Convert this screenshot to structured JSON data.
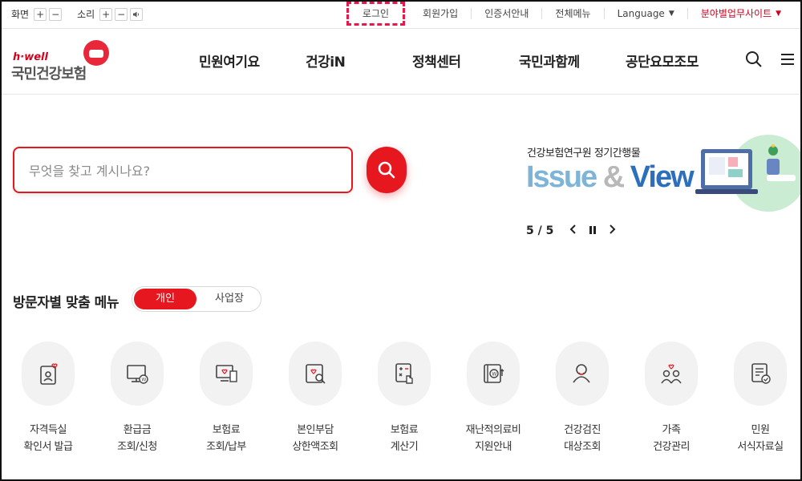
{
  "utility": {
    "screen_label": "화면",
    "sound_label": "소리",
    "plus": "+",
    "minus": "−",
    "links": [
      "로그인",
      "회원가입",
      "인증서안내",
      "전체메뉴"
    ],
    "language": "Language",
    "field_site": "분야별업무사이트"
  },
  "logo": {
    "tagline": "h·well",
    "name": "국민건강보험"
  },
  "nav": {
    "items": [
      "민원여기요",
      "건강iN",
      "정책센터",
      "국민과함께",
      "공단요모조모"
    ]
  },
  "search": {
    "placeholder": "무엇을 찾고 계시나요?"
  },
  "banner": {
    "subtitle": "건강보험연구원 정기간행물",
    "title_issue": "Issue",
    "title_amp": "&",
    "title_view": "View",
    "counter": "5 / 5"
  },
  "custom_menu": {
    "title": "방문자별 맞춤 메뉴",
    "tabs": [
      "개인",
      "사업장"
    ]
  },
  "quick_menu": [
    {
      "line1": "자격득실",
      "line2": "확인서 발급"
    },
    {
      "line1": "환급금",
      "line2": "조회/신청"
    },
    {
      "line1": "보험료",
      "line2": "조회/납부"
    },
    {
      "line1": "본인부담",
      "line2": "상한액조회"
    },
    {
      "line1": "보험료",
      "line2": "계산기"
    },
    {
      "line1": "재난적의료비",
      "line2": "지원안내"
    },
    {
      "line1": "건강검진",
      "line2": "대상조회"
    },
    {
      "line1": "가족",
      "line2": "건강관리"
    },
    {
      "line1": "민원",
      "line2": "서식자료실"
    }
  ],
  "colors": {
    "brand_red": "#e7171f",
    "link_red": "#d6001c",
    "view_blue": "#2c6fbd"
  }
}
